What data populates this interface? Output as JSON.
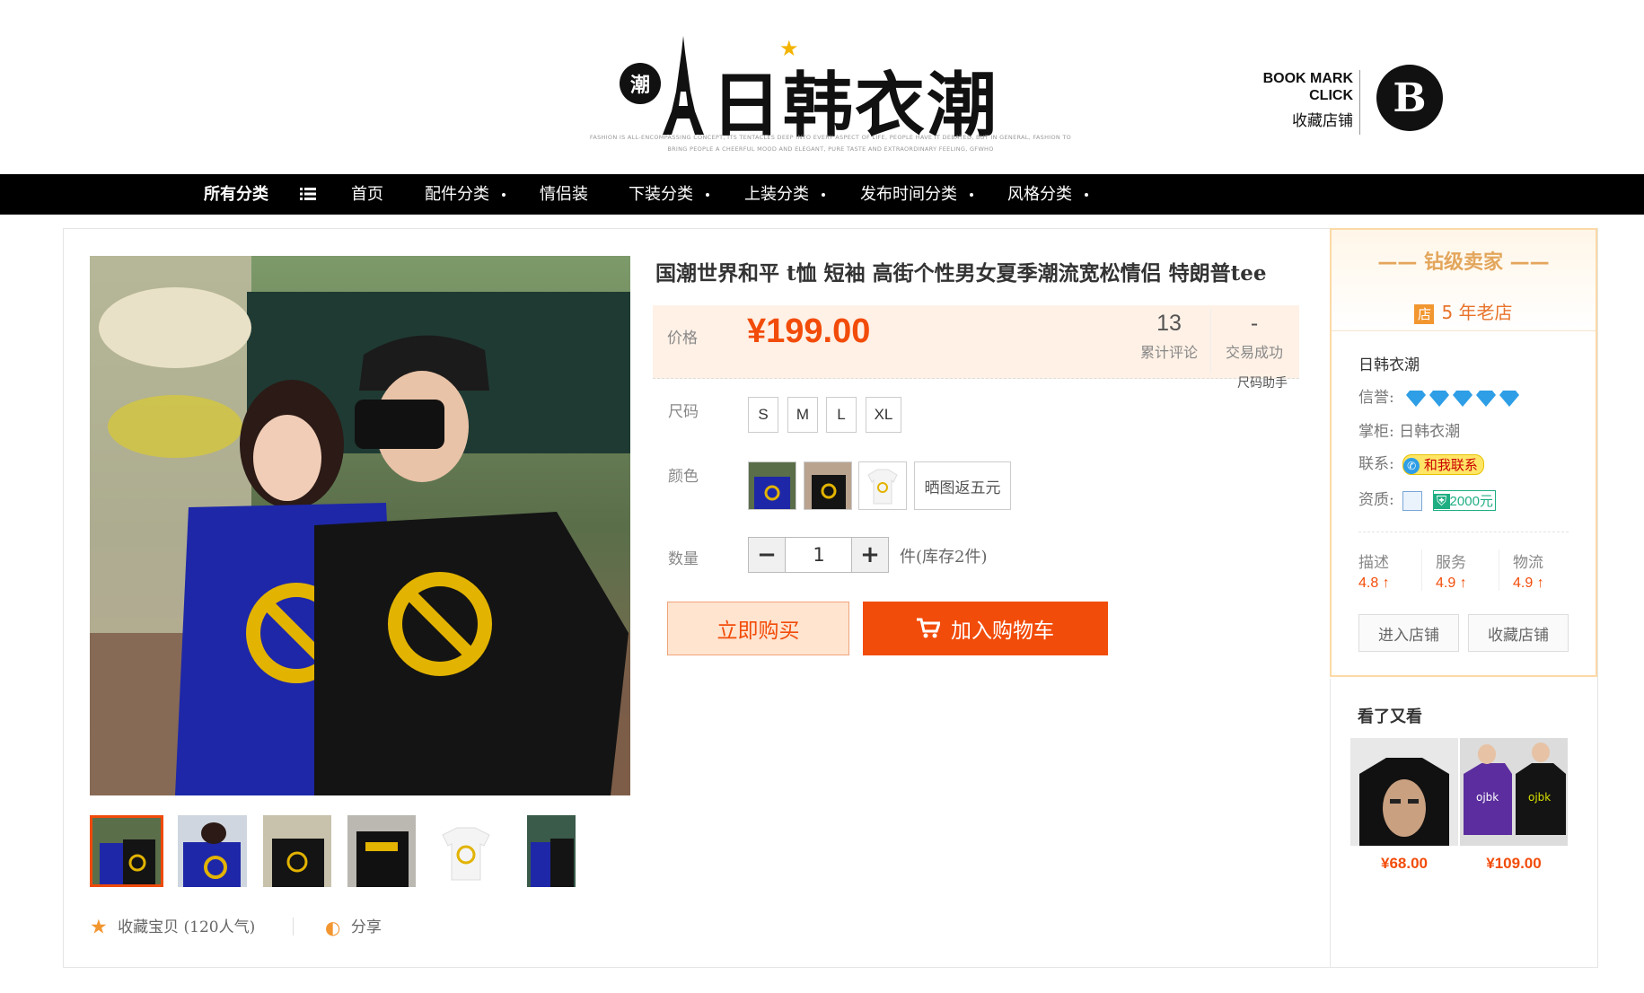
{
  "header": {
    "logo_badge": "潮",
    "logo_text": "日韩衣潮",
    "tagline_1": "FASHION IS ALL-ENCOMPASSING CONCEPT, ITS TENTACLES DEEP INTO EVERY ASPECT OF LIFE, PEOPLE HAVE IT DEBATED, BUT IN GENERAL, FASHION TO",
    "tagline_2": "BRING PEOPLE A CHEERFUL MOOD AND ELEGANT, PURE TASTE AND EXTRAORDINARY FEELING, GFWHO",
    "bookmark_line1": "BOOK MARK",
    "bookmark_line2": "CLICK",
    "bookmark_cn": "收藏店铺",
    "bookmark_logo": "B"
  },
  "nav": {
    "all": "所有分类",
    "home": "首页",
    "accessories": "配件分类",
    "couples": "情侣装",
    "bottoms": "下装分类",
    "tops": "上装分类",
    "release": "发布时间分类",
    "style": "风格分类"
  },
  "gallery": {
    "fav_label": "收藏宝贝",
    "fav_count": "(120人气)",
    "share_label": "分享"
  },
  "product": {
    "title": "国潮世界和平 t恤 短袖 高街个性男女夏季潮流宽松情侣 特朗普tee",
    "price_label": "价格",
    "price": "¥199.00",
    "reviews_num": "13",
    "reviews_label": "累计评论",
    "deals_num": "-",
    "deals_label": "交易成功",
    "size_helper": "尺码助手",
    "size_label": "尺码",
    "sizes": [
      "S",
      "M",
      "L",
      "XL"
    ],
    "color_label": "颜色",
    "color_text_option": "晒图返五元",
    "qty_label": "数量",
    "qty_value": "1",
    "stock": "件(库存2件)",
    "buy_now": "立即购买",
    "add_cart": "加入购物车"
  },
  "seller": {
    "level": "钻级卖家",
    "shop_badge": "店",
    "years": "5 年老店",
    "name": "日韩衣潮",
    "credit_label": "信誉:",
    "keeper_label": "掌柜:",
    "keeper_name": "日韩衣潮",
    "contact_label": "联系:",
    "contact_btn": "和我联系",
    "qual_label": "资质:",
    "deposit": "2000元",
    "dsr": [
      {
        "label": "描述",
        "value": "4.8"
      },
      {
        "label": "服务",
        "value": "4.9"
      },
      {
        "label": "物流",
        "value": "4.9"
      }
    ],
    "enter_shop": "进入店铺",
    "fav_shop": "收藏店铺"
  },
  "also_viewed": {
    "title": "看了又看",
    "items": [
      {
        "price": "¥68.00"
      },
      {
        "price": "¥109.00"
      }
    ]
  },
  "colors": {
    "accent": "#f24c0a",
    "nav_bg": "#000000",
    "price_bg": "#fff1e6",
    "seller_border": "#fcd9a6"
  }
}
